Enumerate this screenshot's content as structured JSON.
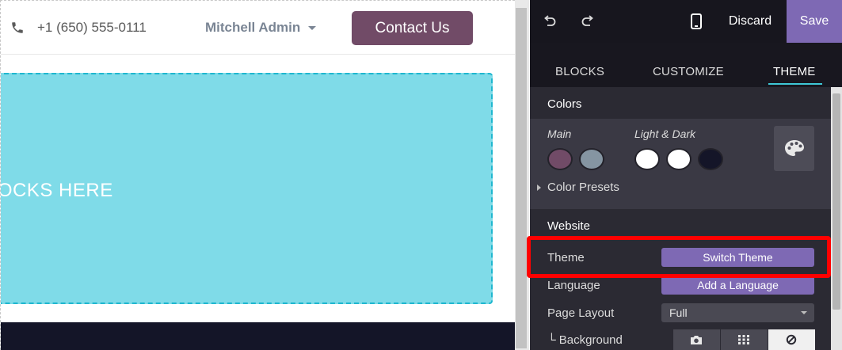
{
  "website": {
    "phone": "+1 (650) 555-0111",
    "user_name": "Mitchell Admin",
    "contact_button": "Contact Us",
    "dropzone_text": "LOCKS HERE",
    "accent_color": "#714b67"
  },
  "editor": {
    "toolbar": {
      "undo_icon": "undo-icon",
      "redo_icon": "redo-icon",
      "mobile_icon": "mobile-preview-icon",
      "discard": "Discard",
      "save": "Save"
    },
    "tabs": [
      "BLOCKS",
      "CUSTOMIZE",
      "THEME"
    ],
    "active_tab": "THEME",
    "colors": {
      "title": "Colors",
      "main_label": "Main",
      "light_dark_label": "Light & Dark",
      "main_swatches": [
        "#714b67",
        "#8595a2"
      ],
      "light_dark_swatches": [
        "#ffffff",
        "#ffffff",
        "#141528"
      ],
      "palette_icon": "palette-icon",
      "presets_label": "Color Presets"
    },
    "website_section": {
      "title": "Website",
      "theme_label": "Theme",
      "theme_button": "Switch Theme",
      "language_label": "Language",
      "language_button": "Add a Language",
      "layout_label": "Page Layout",
      "layout_value": "Full",
      "background_label": "└ Background",
      "background_options": [
        "camera-icon",
        "pattern-icon",
        "none-icon"
      ],
      "background_selected": "none-icon"
    },
    "highlight_color": "#ff0000"
  }
}
